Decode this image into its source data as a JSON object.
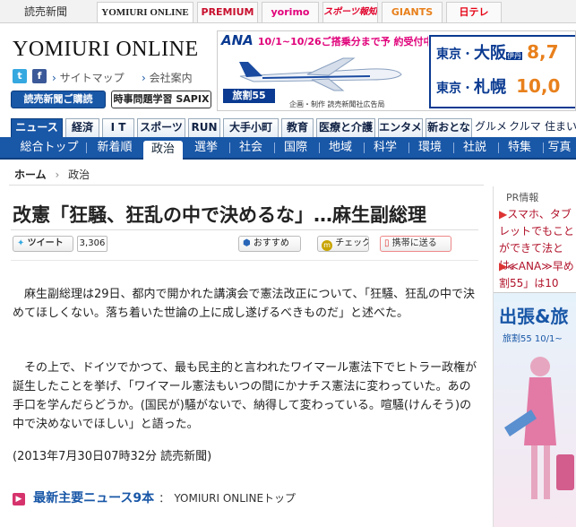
{
  "topbar": {
    "tabs": [
      "読売新聞",
      "YOMIURI ONLINE",
      "PREMIUM",
      "yorimo",
      "スポーツ報知",
      "GIANTS",
      "日テレ"
    ]
  },
  "site": {
    "logo": "YOMIURI ONLINE",
    "twitter_icon": "t",
    "facebook_icon": "f",
    "links": [
      "サイトマップ",
      "会社案内"
    ],
    "subscribe_label": "読売新聞ご購読",
    "sapix_label": "時事問題学習 SAPIX"
  },
  "ad_banner": {
    "text": "10/1~10/26ご搭乗分まで予 約受付中!",
    "brand": "ANA",
    "sub_brand": "旅割55",
    "footer": "企画・制作 読売新聞社広告局",
    "route1_from": "東京",
    "route1_to": "大阪",
    "route1_note": "伊丹",
    "route1_price": "8,7",
    "route2_from": "東京",
    "route2_to": "札幌",
    "route2_price": "10,0"
  },
  "categories": [
    "ニュース",
    "経済",
    "I T",
    "スポーツ",
    "RUN",
    "大手小町",
    "教育",
    "医療と介護",
    "エンタメ",
    "新おとな",
    "グルメ",
    "クルマ",
    "住まい"
  ],
  "subnav": [
    "総合トップ",
    "新着順",
    "政治",
    "選挙",
    "社会",
    "国際",
    "地域",
    "科学",
    "環境",
    "社説",
    "特集",
    "写真"
  ],
  "breadcrumb": {
    "home": "ホーム",
    "current": "政治"
  },
  "article": {
    "title": "改憲「狂騒、狂乱の中で決めるな」…麻生副総理",
    "tweet_label": "ツイート",
    "tweet_count": "3,306",
    "recommend_label": "おすすめ",
    "check_label": "チェック",
    "mobile_label": "携帯に送る",
    "p1": "麻生副総理は29日、都内で開かれた講演会で憲法改正について、「狂騒、狂乱の中で決めてほしくない。落ち着いた世論の上に成し遂げるべきものだ」と述べた。",
    "p2": "その上で、ドイツでかつて、最も民主的と言われたワイマール憲法下でヒトラー政権が誕生したことを挙げ、「ワイマール憲法もいつの間にかナチス憲法に変わっていた。あの手口を学んだらどうか。(国民が)騒がないで、納得して変わっている。喧騒(けんそう)の中で決めないでほしい」と語った。",
    "date": "(2013年7月30日07時32分  読売新聞)",
    "latest_label": "最新主要ニュース9本",
    "latest_link": "YOMIURI ONLINEトップ"
  },
  "sidebar": {
    "pr_label": "PR情報",
    "item1": "スマホ、タブレットでもことができて法とは。",
    "item2": "≪ANA≫早め割55」は10",
    "ad_title": "出張&旅",
    "ad_sub": "旅割55  10/1~"
  }
}
